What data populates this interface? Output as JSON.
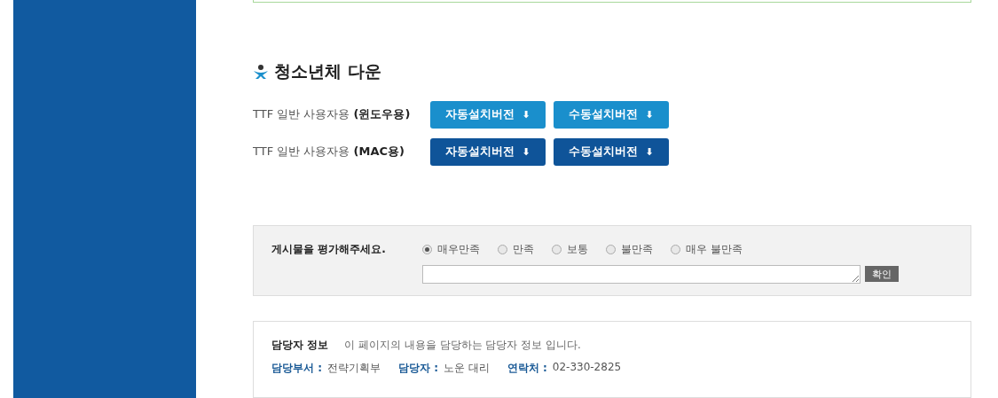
{
  "heading": "청소년체 다운",
  "downloads": [
    {
      "label": "TTF 일반 사용자용 **(윈도우용)**",
      "color": "#1a8fcc",
      "buttons": [
        "자동설치버전",
        "수동설치버전"
      ],
      "icon": "⬇"
    },
    {
      "label": "TTF 일반 사용자용 **(MAC용)**",
      "color": "#0f5499",
      "buttons": [
        "자동설치버전",
        "수동설치버전"
      ],
      "icon": "⬇"
    }
  ],
  "rating": {
    "prompt": "게시물을 평가해주세요.",
    "options": [
      {
        "label": "매우만족",
        "selected": true
      },
      {
        "label": "만족",
        "selected": false
      },
      {
        "label": "보통",
        "selected": false
      },
      {
        "label": "불만족",
        "selected": false
      },
      {
        "label": "매우 불만족",
        "selected": false
      }
    ],
    "submit": "확인"
  },
  "contact": {
    "title": "담당자 정보",
    "description": "이 페이지의 내용을 담당하는 담당자 정보 입니다.",
    "fields": [
      {
        "label": "담당부서 :",
        "value": "전략기획부"
      },
      {
        "label": "담당자 :",
        "value": "노운 대리"
      },
      {
        "label": "연락처 :",
        "value": "02-330-2825"
      }
    ]
  }
}
